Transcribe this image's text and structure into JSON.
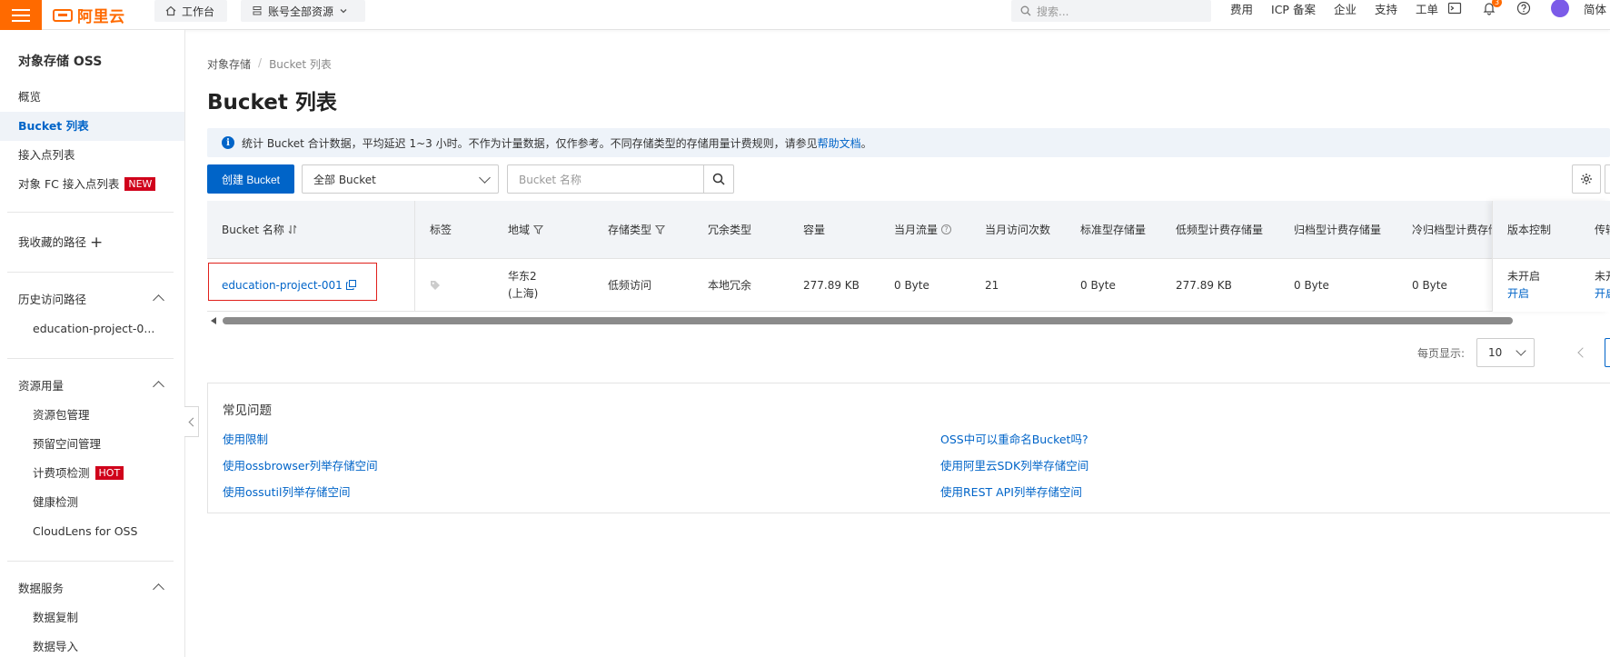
{
  "topbar": {
    "logo_text": "阿里云",
    "workbench": "工作台",
    "resources": "账号全部资源",
    "search_placeholder": "搜索...",
    "links": [
      "费用",
      "ICP 备案",
      "企业",
      "支持",
      "工单"
    ],
    "notification_count": "3",
    "lang": "简体"
  },
  "sidebar": {
    "title": "对象存储 OSS",
    "items": [
      {
        "label": "概览"
      },
      {
        "label": "Bucket 列表"
      },
      {
        "label": "接入点列表"
      },
      {
        "label": "对象 FC 接入点列表",
        "tag": "NEW"
      }
    ],
    "favorites": "我收藏的路径",
    "history": {
      "label": "历史访问路径",
      "items": [
        "education-project-0..."
      ]
    },
    "usage": {
      "label": "资源用量",
      "items": [
        {
          "label": "资源包管理"
        },
        {
          "label": "预留空间管理"
        },
        {
          "label": "计费项检测",
          "tag": "HOT"
        },
        {
          "label": "健康检测"
        },
        {
          "label": "CloudLens for OSS"
        }
      ]
    },
    "data_service": {
      "label": "数据服务",
      "items": [
        "数据复制",
        "数据导入"
      ]
    }
  },
  "main": {
    "breadcrumb": [
      "对象存储",
      "Bucket 列表"
    ],
    "title": "Bucket 列表",
    "notice": {
      "text": "统计 Bucket 合计数据，平均延迟 1~3 小时。不作为计量数据，仅作参考。不同存储类型的存储用量计费规则，请参见",
      "link": "帮助文档",
      "suffix": "。"
    },
    "create_button": "创建 Bucket",
    "filter_select": "全部 Bucket",
    "search_placeholder": "Bucket 名称",
    "table": {
      "headers": {
        "name": "Bucket 名称",
        "tags": "标签",
        "region": "地域",
        "storage_class": "存储类型",
        "redundancy": "冗余类型",
        "capacity": "容量",
        "monthly_traffic": "当月流量",
        "monthly_requests": "当月访问次数",
        "standard_storage": "标准型存储量",
        "ia_storage": "低频型计费存储量",
        "archive_storage": "归档型计费存储量",
        "cold_archive_storage": "冷归档型计费存储",
        "versioning": "版本控制",
        "transfer": "传输"
      },
      "rows": [
        {
          "name": "education-project-001",
          "region_line1": "华东2",
          "region_line2": "(上海)",
          "storage_class": "低频访问",
          "redundancy": "本地冗余",
          "capacity": "277.89 KB",
          "monthly_traffic": "0 Byte",
          "monthly_requests": "21",
          "standard_storage": "0 Byte",
          "ia_storage": "277.89 KB",
          "archive_storage": "0 Byte",
          "cold_archive_storage": "0 Byte",
          "versioning_status": "未开启",
          "versioning_action": "开启",
          "transfer_status": "未开",
          "transfer_action": "开启"
        }
      ]
    },
    "pagination": {
      "page_size_label": "每页显示:",
      "page_size": "10"
    },
    "faq": {
      "title": "常见问题",
      "links_left": [
        "使用限制",
        "使用ossbrowser列举存储空间",
        "使用ossutil列举存储空间"
      ],
      "links_right": [
        "OSS中可以重命名Bucket吗?",
        "使用阿里云SDK列举存储空间",
        "使用REST API列举存储空间"
      ]
    }
  }
}
